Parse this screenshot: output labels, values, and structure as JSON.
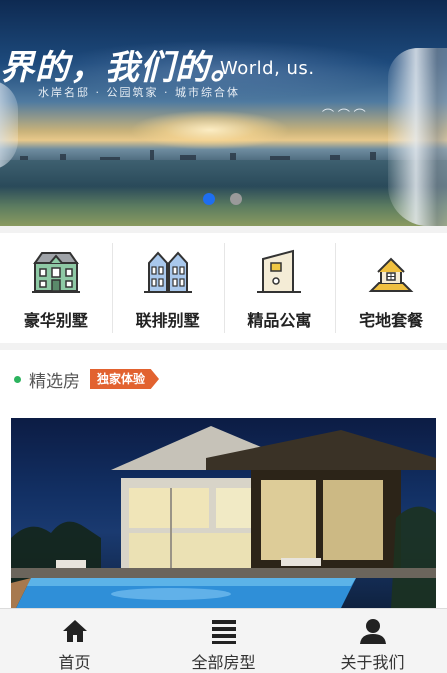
{
  "banner": {
    "headline_cn": "界的，我们的。",
    "headline_en": "World, us.",
    "subline": "水岸名邸 · 公园筑家 · 城市综合体",
    "slides": 2,
    "active_slide": 1,
    "dot_active_color": "#1e6ef0"
  },
  "categories": [
    {
      "label": "豪华别墅",
      "icon": "villa-icon"
    },
    {
      "label": "联排别墅",
      "icon": "townhouse-icon"
    },
    {
      "label": "精品公寓",
      "icon": "apartment-icon"
    },
    {
      "label": "宅地套餐",
      "icon": "land-house-icon"
    }
  ],
  "featured": {
    "title": "精选房",
    "badge": "独家体验",
    "photo": "luxury-villa-pool-night"
  },
  "tabbar": {
    "items": [
      {
        "label": "首页",
        "icon": "home-icon"
      },
      {
        "label": "全部房型",
        "icon": "list-icon"
      },
      {
        "label": "关于我们",
        "icon": "user-icon"
      }
    ]
  },
  "colors": {
    "badge": "#e2622f",
    "section_dot": "#2cb35e"
  }
}
